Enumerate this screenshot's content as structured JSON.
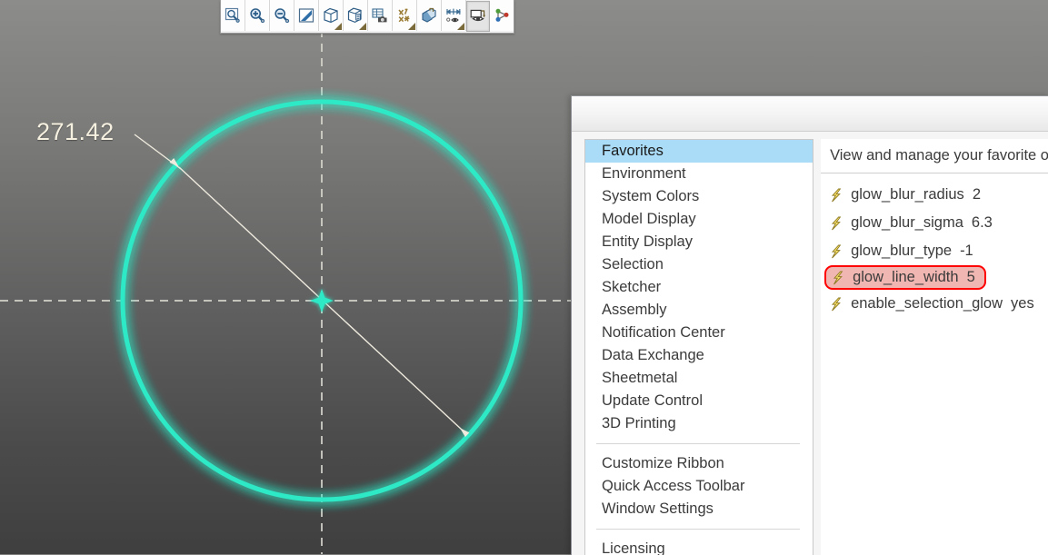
{
  "viewport": {
    "dimension_label": "271.42",
    "geometry": {
      "shape": "circle",
      "center_marker": "center-point-star",
      "circle_color": "#2fe9c6",
      "glow_color": "#2fe9c6",
      "axis_line_color": "#d8d8d0",
      "dimension_line_color": "#efeade"
    },
    "background": {
      "top_color": "#8c8c8a",
      "bottom_color": "#3f3f3f"
    }
  },
  "toolbar": {
    "buttons": [
      {
        "name": "zoom-area-icon",
        "tooltip": "Zoom Area",
        "dropdown": false,
        "active": false
      },
      {
        "name": "zoom-in-icon",
        "tooltip": "Zoom In",
        "dropdown": false,
        "active": false
      },
      {
        "name": "zoom-out-icon",
        "tooltip": "Zoom Out",
        "dropdown": false,
        "active": false
      },
      {
        "name": "refit-view-icon",
        "tooltip": "Refit",
        "dropdown": false,
        "active": false
      },
      {
        "name": "display-style-cube-icon",
        "tooltip": "Display Style",
        "dropdown": true,
        "active": false
      },
      {
        "name": "saved-views-icon",
        "tooltip": "Saved Views",
        "dropdown": true,
        "active": false
      },
      {
        "name": "view-capture-camera-icon",
        "tooltip": "View Capture",
        "dropdown": false,
        "active": false
      },
      {
        "name": "datum-display-icon",
        "tooltip": "Datum Display Filters",
        "dropdown": true,
        "active": false
      },
      {
        "name": "appearance-gallery-icon",
        "tooltip": "Appearance Gallery",
        "dropdown": false,
        "active": false
      },
      {
        "name": "annotation-display-icon",
        "tooltip": "Annotation Display",
        "dropdown": true,
        "active": false
      },
      {
        "name": "spin-center-display-icon",
        "tooltip": "Spin Center",
        "dropdown": false,
        "active": true
      },
      {
        "name": "relations-graph-icon",
        "tooltip": "Relations",
        "dropdown": false,
        "active": false
      }
    ]
  },
  "dialog": {
    "sidebar": {
      "groups": [
        {
          "items": [
            "Favorites",
            "Environment",
            "System Colors",
            "Model Display",
            "Entity Display",
            "Selection",
            "Sketcher",
            "Assembly",
            "Notification Center",
            "Data Exchange",
            "Sheetmetal",
            "Update Control",
            "3D Printing"
          ]
        },
        {
          "items": [
            "Customize Ribbon",
            "Quick Access Toolbar",
            "Window Settings"
          ]
        },
        {
          "items": [
            "Licensing"
          ]
        }
      ],
      "selected": "Favorites",
      "selected_index": 0,
      "selection_color": "#aadcf7"
    },
    "pane": {
      "title": "View and manage your favorite o",
      "options": [
        {
          "icon": "lightning-bolt-icon",
          "name": "glow_blur_radius",
          "value": "2",
          "highlighted": false
        },
        {
          "icon": "lightning-bolt-icon",
          "name": "glow_blur_sigma",
          "value": "6.3",
          "highlighted": false
        },
        {
          "icon": "lightning-bolt-icon",
          "name": "glow_blur_type",
          "value": "-1",
          "highlighted": false
        },
        {
          "icon": "lightning-bolt-icon",
          "name": "glow_line_width",
          "value": "5",
          "highlighted": true
        },
        {
          "icon": "lightning-bolt-icon",
          "name": "enable_selection_glow",
          "value": "yes",
          "highlighted": false
        }
      ],
      "highlight_border_color": "#ff0000",
      "highlight_fill_color": "#f0b6b1"
    }
  }
}
